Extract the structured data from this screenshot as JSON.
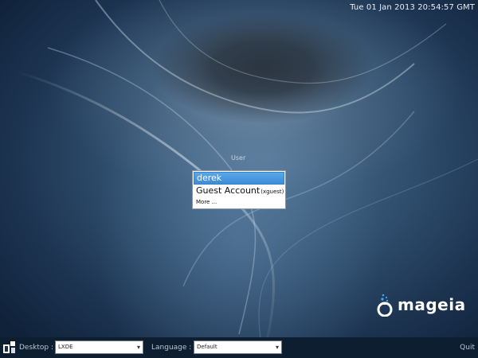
{
  "clock": "Tue 01 Jan 2013 20:54:57 GMT",
  "login": {
    "label": "User",
    "users": [
      {
        "name": "derek",
        "login": "",
        "selected": true
      },
      {
        "name": "Guest Account",
        "login": "(xguest)",
        "selected": false
      }
    ],
    "more_label": "More ..."
  },
  "branding": {
    "logo_text": "mageia",
    "logo_icon": "mageia-cauldron-icon"
  },
  "bottom_bar": {
    "desktop_label": "Desktop :",
    "desktop_value": "LXDE",
    "language_label": "Language :",
    "language_value": "Default",
    "quit_label": "Quit"
  },
  "colors": {
    "selection": "#3d8cd6",
    "bar_background": "#0e1e31",
    "logo_accent": "#3fa9f5"
  }
}
